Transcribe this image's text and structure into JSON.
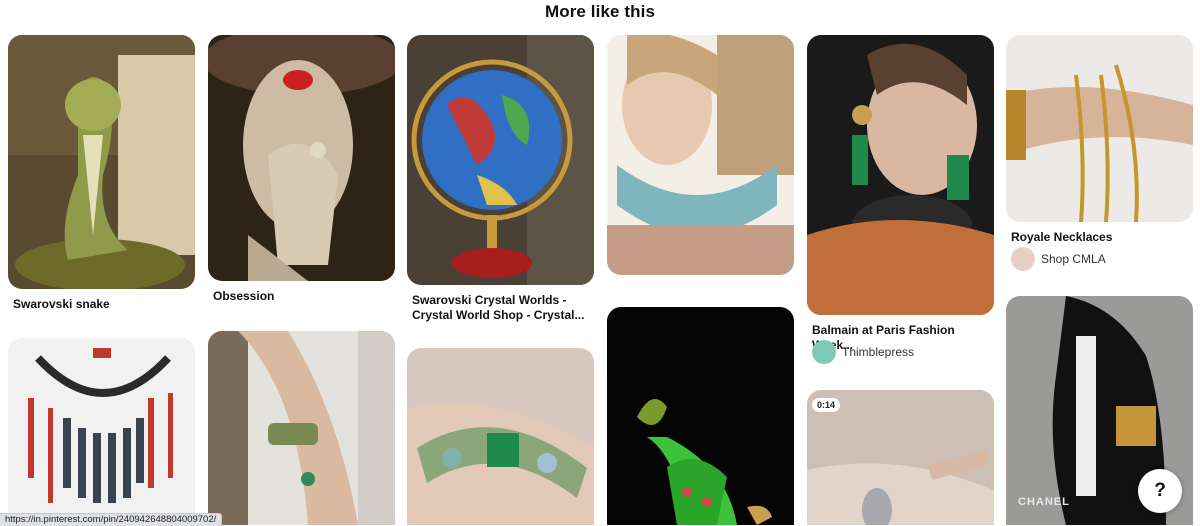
{
  "section": {
    "heading": "More like this"
  },
  "pins": [
    {
      "title": "Swarovski snake",
      "title_line2": ""
    },
    {
      "title": "Obsession",
      "title_line2": ""
    },
    {
      "title": "Swarovski Crystal Worlds -",
      "title_line2": "Crystal World Shop - Crystal..."
    },
    {
      "title": "",
      "title_line2": ""
    },
    {
      "title": "Balmain at Paris Fashion Week...",
      "title_line2": "",
      "source": "Thimblepress"
    },
    {
      "title": "Royale Necklaces",
      "title_line2": "",
      "source": "Shop CMLA"
    }
  ],
  "video_badge": "0:14",
  "watermark": "CHANEL",
  "help_button": "?",
  "status_url": "https://in.pinterest.com/pin/240942648804009702/",
  "colors": {
    "background": "#ffffff",
    "text": "#111111",
    "status_bar": "#dfe1e5"
  }
}
